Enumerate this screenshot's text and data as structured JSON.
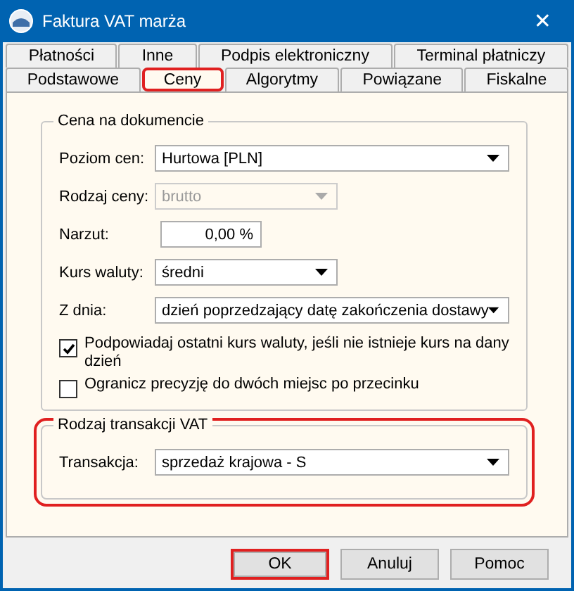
{
  "window": {
    "title": "Faktura VAT marża",
    "close": "✕"
  },
  "tab_rows": [
    [
      {
        "label": "Płatności",
        "selected": false,
        "highlighted": false
      },
      {
        "label": "Inne",
        "selected": false,
        "highlighted": false
      },
      {
        "label": "Podpis elektroniczny",
        "selected": false,
        "highlighted": false
      },
      {
        "label": "Terminal płatniczy",
        "selected": false,
        "highlighted": false
      }
    ],
    [
      {
        "label": "Podstawowe",
        "selected": false,
        "highlighted": false
      },
      {
        "label": "Ceny",
        "selected": true,
        "highlighted": true
      },
      {
        "label": "Algorytmy",
        "selected": false,
        "highlighted": false
      },
      {
        "label": "Powiązane",
        "selected": false,
        "highlighted": false
      },
      {
        "label": "Fiskalne",
        "selected": false,
        "highlighted": false
      }
    ]
  ],
  "price_group": {
    "title": "Cena na dokumencie",
    "highlighted": false,
    "fields": [
      {
        "kind": "select",
        "label": "Poziom cen:",
        "value": "Hurtowa [PLN]",
        "disabled": false
      },
      {
        "kind": "select",
        "label": "Rodzaj ceny:",
        "value": "brutto",
        "disabled": true
      },
      {
        "kind": "text",
        "label": "Narzut:",
        "value": "0,00 %",
        "disabled": false
      },
      {
        "kind": "select",
        "label": "Kurs waluty:",
        "value": "średni",
        "disabled": false
      },
      {
        "kind": "select",
        "label": "Z dnia:",
        "value": "dzień poprzedzający datę zakończenia dostawy",
        "disabled": false
      }
    ],
    "checkboxes": [
      {
        "label": "Podpowiadaj ostatni kurs waluty, jeśli nie istnieje kurs na dany dzień",
        "checked": true
      },
      {
        "label": "Ogranicz precyzję do dwóch miejsc po przecinku",
        "checked": false
      }
    ]
  },
  "vat_group": {
    "title": "Rodzaj transakcji VAT",
    "highlighted": true,
    "fields": [
      {
        "kind": "select",
        "label": "Transakcja:",
        "value": "sprzedaż krajowa - S",
        "disabled": false
      }
    ]
  },
  "buttons": [
    {
      "label": "OK",
      "highlighted": true
    },
    {
      "label": "Anuluj",
      "highlighted": false
    },
    {
      "label": "Pomoc",
      "highlighted": false
    }
  ]
}
